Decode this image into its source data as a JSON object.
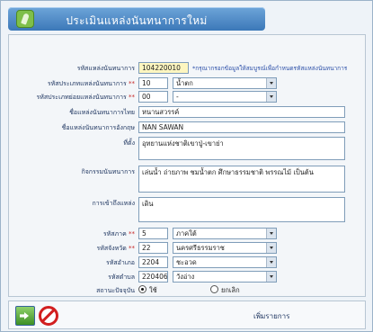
{
  "window": {
    "title": "ประเมินแหล่งนันทนาการใหม่"
  },
  "form": {
    "code": {
      "label": "รหัสแหล่งนันทนาการ",
      "value": "104220010",
      "note": "*กรุณากรอกข้อมูลให้สมบูรณ์เพื่อกำหนดรหัสแหล่งนันทนาการ"
    },
    "type": {
      "label": "รหัสประเภทแหล่งนันทนาการ",
      "code": "10",
      "selected": "น้ำตก"
    },
    "subtype": {
      "label": "รหัสประเภทย่อยแหล่งนันทนาการ",
      "code": "00",
      "selected": "-"
    },
    "name_th": {
      "label": "ชื่อแหล่งนันทนาการไทย",
      "value": "หนานสวรรค์"
    },
    "name_en": {
      "label": "ชื่อแหล่งนันทนาการอังกฤษ",
      "value": "NAN SAWAN"
    },
    "location": {
      "label": "ที่ตั้ง",
      "value": "อุทยานแห่งชาติเขาปู่-เขาย่า"
    },
    "activity": {
      "label": "กิจกรรมนันทนาการ",
      "value": "เล่นน้ำ ถ่ายภาพ ชมน้ำตก ศึกษาธรรมชาติ พรรณไม้ เป็นต้น"
    },
    "access": {
      "label": "การเข้าถึงแหล่ง",
      "value": "เดิน"
    },
    "region": {
      "label": "รหัสภาค",
      "code": "5",
      "selected": "ภาคใต้"
    },
    "province": {
      "label": "รหัสจังหวัด",
      "code": "22",
      "selected": "นครศรีธรรมราช"
    },
    "district": {
      "label": "รหัสอำเภอ",
      "code": "2204",
      "selected": "ชะอวด"
    },
    "subdistrict": {
      "label": "รหัสตำบล",
      "code": "220406",
      "selected": "วังอ่าง"
    },
    "status": {
      "label": "สถานะปัจจุบัน",
      "options": [
        "ใช้",
        "ยกเลิก"
      ],
      "selected": "ใช้"
    }
  },
  "footer": {
    "save_label": "เพิ่มรายการ"
  },
  "icons": {
    "exit": "exit-arrow-icon",
    "cancel": "cancel-icon"
  },
  "colors": {
    "title_bar": "#3b78b8",
    "required": "#c62828",
    "highlight_input": "#fdf6c0"
  }
}
